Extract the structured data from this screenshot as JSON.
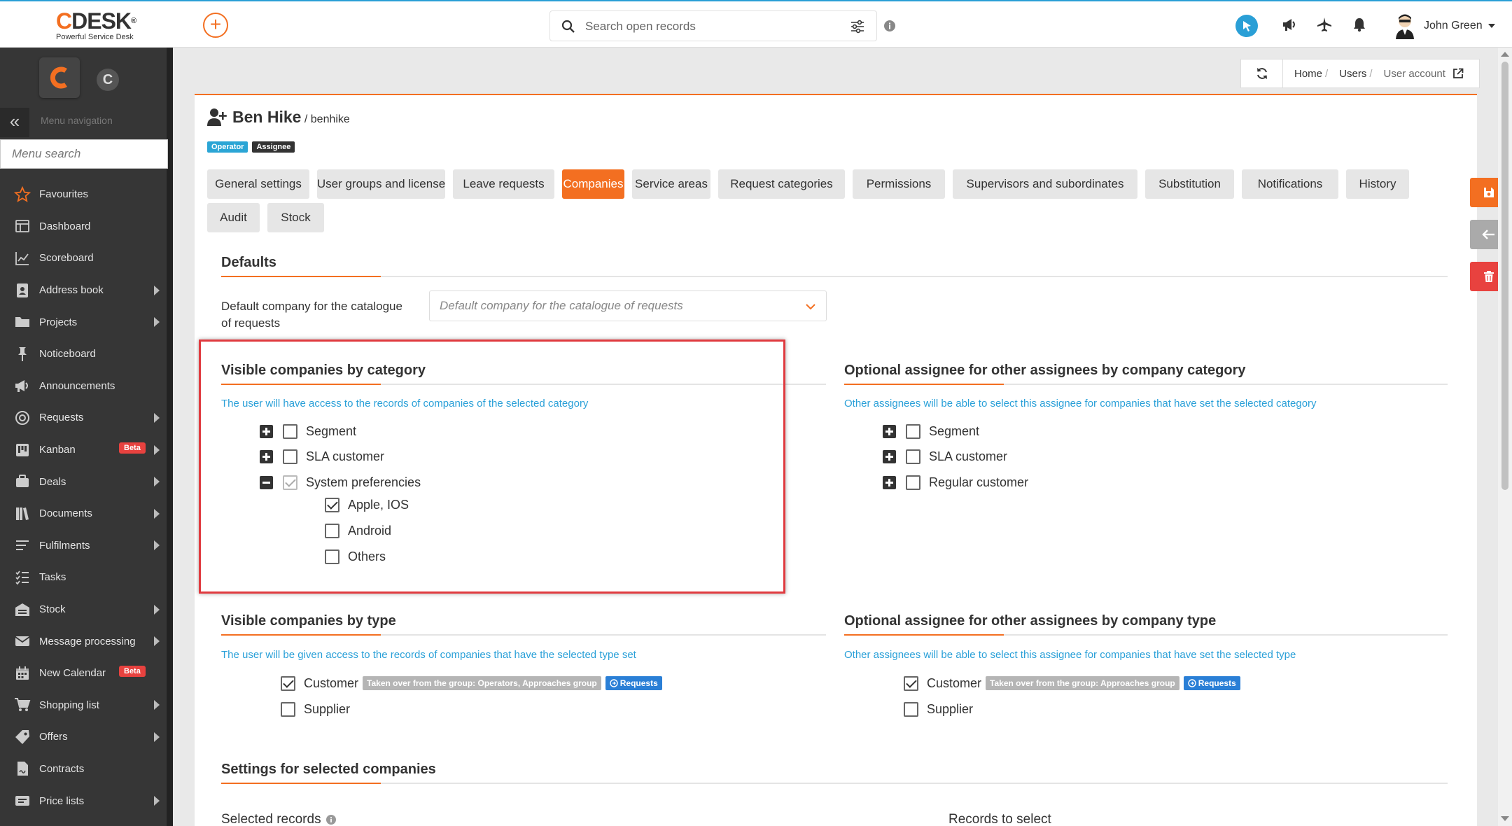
{
  "topbar": {
    "logo_main": "CDESK",
    "logo_mark": "®",
    "logo_sub": "Powerful Service Desk",
    "search_placeholder": "Search open records",
    "user_name": "John Green"
  },
  "sidebar": {
    "menu_navigation": "Menu navigation",
    "search_placeholder": "Menu search",
    "items": [
      {
        "label": "Favourites",
        "icon": "star-icon",
        "arrow": false
      },
      {
        "label": "Dashboard",
        "icon": "dashboard-icon",
        "arrow": false
      },
      {
        "label": "Scoreboard",
        "icon": "chart-line-icon",
        "arrow": false
      },
      {
        "label": "Address book",
        "icon": "address-book-icon",
        "arrow": true
      },
      {
        "label": "Projects",
        "icon": "projects-icon",
        "arrow": true
      },
      {
        "label": "Noticeboard",
        "icon": "pin-icon",
        "arrow": false
      },
      {
        "label": "Announcements",
        "icon": "megaphone-icon",
        "arrow": false
      },
      {
        "label": "Requests",
        "icon": "requests-icon",
        "arrow": true
      },
      {
        "label": "Kanban",
        "icon": "kanban-icon",
        "arrow": true,
        "beta": "Beta"
      },
      {
        "label": "Deals",
        "icon": "deals-icon",
        "arrow": true
      },
      {
        "label": "Documents",
        "icon": "documents-icon",
        "arrow": true
      },
      {
        "label": "Fulfilments",
        "icon": "fulfilments-icon",
        "arrow": true
      },
      {
        "label": "Tasks",
        "icon": "tasks-icon",
        "arrow": false
      },
      {
        "label": "Stock",
        "icon": "stock-icon",
        "arrow": true
      },
      {
        "label": "Message processing",
        "icon": "envelope-icon",
        "arrow": true
      },
      {
        "label": "New Calendar",
        "icon": "calendar-icon",
        "arrow": false,
        "beta": "Beta"
      },
      {
        "label": "Shopping list",
        "icon": "cart-icon",
        "arrow": true
      },
      {
        "label": "Offers",
        "icon": "tag-icon",
        "arrow": true
      },
      {
        "label": "Contracts",
        "icon": "contract-icon",
        "arrow": false
      },
      {
        "label": "Price lists",
        "icon": "price-list-icon",
        "arrow": true
      }
    ]
  },
  "breadcrumb": {
    "home": "Home",
    "users": "Users",
    "current": "User account"
  },
  "user": {
    "name": "Ben Hike",
    "login": " / benhike",
    "badge1": "Operator",
    "badge2": "Assignee"
  },
  "tabs": [
    "General settings",
    "User groups and license",
    "Leave requests",
    "Companies",
    "Service areas",
    "Request categories",
    "Permissions",
    "Supervisors and subordinates",
    "Substitution",
    "Notifications",
    "History",
    "Audit",
    "Stock"
  ],
  "active_tab": "Companies",
  "defaults": {
    "title": "Defaults",
    "field_label": "Default company for the catalogue of requests",
    "select_placeholder": "Default company for the catalogue of requests"
  },
  "vis_category": {
    "title": "Visible companies by category",
    "note": "The user will have access to the records of companies of the selected category",
    "items": {
      "segment": "Segment",
      "sla": "SLA customer",
      "system": "System preferencies",
      "apple": "Apple, IOS",
      "android": "Android",
      "others": "Others"
    }
  },
  "opt_category": {
    "title": "Optional assignee for other assignees by company category",
    "note": "Other assignees will be able to select this assignee for companies that have set the selected category",
    "items": {
      "segment": "Segment",
      "sla": "SLA customer",
      "regular": "Regular customer"
    }
  },
  "vis_type": {
    "title": "Visible companies by type",
    "note": "The user will be given access to the records of companies that have the selected type set",
    "customer": "Customer",
    "customer_tag": "Taken over from the group: Operators, Approaches group",
    "requests_tag": "Requests",
    "supplier": "Supplier"
  },
  "opt_type": {
    "title": "Optional assignee for other assignees by company type",
    "note": "Other assignees will be able to select this assignee for companies that have set the selected type",
    "customer": "Customer",
    "customer_tag": "Taken over from the group: Approaches group",
    "requests_tag": "Requests",
    "supplier": "Supplier"
  },
  "settings": {
    "title": "Settings for selected companies",
    "selected_records": "Selected records",
    "records_to_select": "Records to select"
  },
  "colors": {
    "accent": "#f36f21",
    "info_blue": "#2aa0d8",
    "danger": "#e8423f",
    "highlight": "#e03a3f"
  }
}
